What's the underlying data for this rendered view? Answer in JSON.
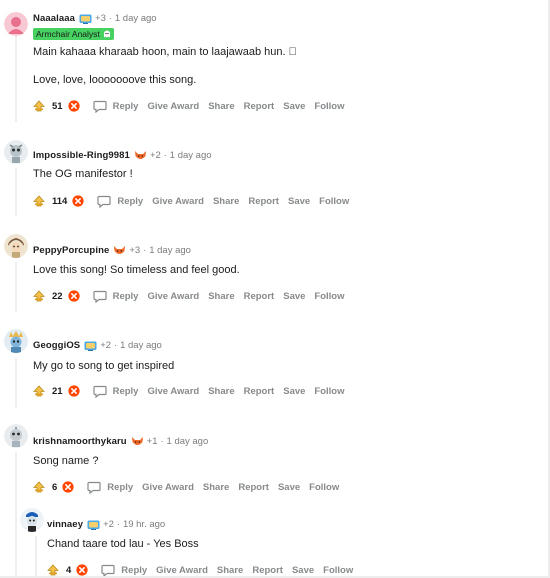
{
  "colors": {
    "flair_bg": "#46d160",
    "downvote": "#ff4500",
    "meta_gray": "#7c7c7c",
    "action_gray": "#878a8c"
  },
  "actions": {
    "reply": "Reply",
    "give_award": "Give Award",
    "share": "Share",
    "report": "Report",
    "save": "Save",
    "follow": "Follow"
  },
  "comments": [
    {
      "username": "Naaalaaa",
      "award_icon": "award-tv-icon",
      "award_count": "+3",
      "time": "1 day ago",
      "flair": "Armchair Analyst",
      "flair_icon": "ghost-icon",
      "body": [
        "Main kahaaa kharaab hoon, main to laajawaab hun. \u0000",
        "Love, love, looooooove this song."
      ],
      "score": "51"
    },
    {
      "username": "Impossible-Ring9981",
      "award_icon": "award-fox-icon",
      "award_count": "+2",
      "time": "1 day ago",
      "body": [
        "The OG manifestor !"
      ],
      "score": "114"
    },
    {
      "username": "PeppyPorcupine",
      "award_icon": "award-fox-icon",
      "award_count": "+3",
      "time": "1 day ago",
      "body": [
        "Love this song! So timeless and feel good."
      ],
      "score": "22"
    },
    {
      "username": "GeoggiOS",
      "award_icon": "award-tv-icon",
      "award_count": "+2",
      "time": "1 day ago",
      "body": [
        "My go to song to get inspired"
      ],
      "score": "21"
    },
    {
      "username": "krishnamoorthykaru",
      "award_icon": "award-fox-icon",
      "award_count": "+1",
      "time": "1 day ago",
      "body": [
        "Song name ?"
      ],
      "score": "6"
    },
    {
      "username": "vinnaey",
      "award_icon": "award-tv-icon",
      "award_count": "+2",
      "time": "19 hr. ago",
      "body": [
        "Chand taare tod lau - Yes Boss"
      ],
      "score": "4"
    }
  ]
}
